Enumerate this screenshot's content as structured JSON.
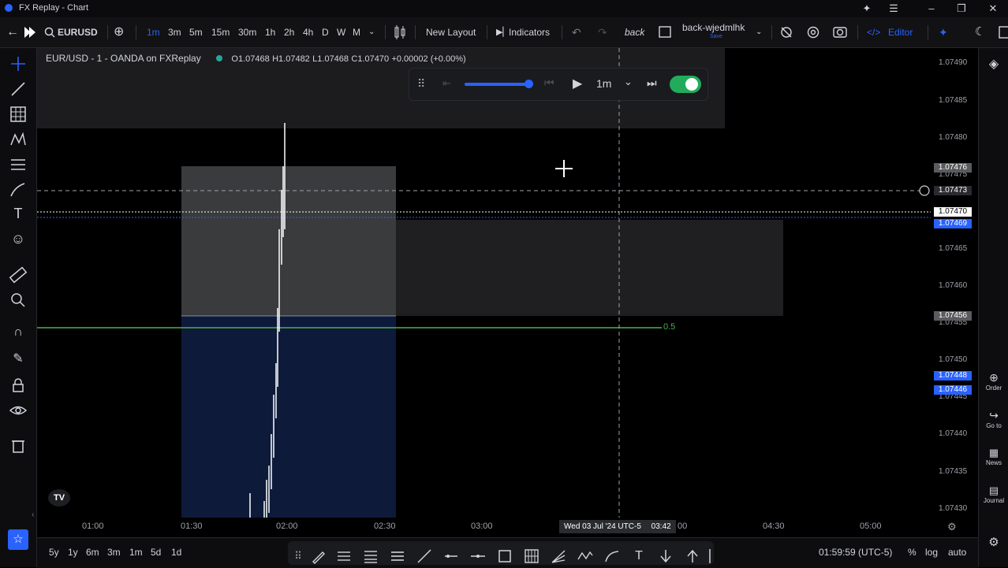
{
  "window": {
    "title": "FX Replay - Chart"
  },
  "toolbar": {
    "symbol": "EURUSD",
    "timeframes": [
      "1m",
      "3m",
      "5m",
      "15m",
      "30m",
      "1h",
      "2h",
      "4h",
      "D",
      "W",
      "M"
    ],
    "active_timeframe": "1m",
    "new_layout": "New Layout",
    "indicators": "Indicators",
    "back": "back",
    "layout_name": "back-wjedmlhk",
    "layout_sub": "Save",
    "editor": "Editor"
  },
  "legend": {
    "symbol": "EUR/USD - 1 - OANDA on FXReplay",
    "o": "O1.07468",
    "h": "H1.07482",
    "l": "L1.07468",
    "c": "C1.07470",
    "change": "+0.00002 (+0.00%)"
  },
  "replay": {
    "speed": "1m",
    "progress": 0.85,
    "toggle_on": true
  },
  "price_axis": {
    "labels": [
      "1.07490",
      "1.07485",
      "1.07480",
      "1.07475",
      "1.07465",
      "1.07460",
      "1.07455",
      "1.07450",
      "1.07445",
      "1.07440",
      "1.07435",
      "1.07430"
    ],
    "badges": [
      {
        "value": "1.07476",
        "kind": "gray"
      },
      {
        "value": "1.07473",
        "kind": "dark"
      },
      {
        "value": "1.07470",
        "kind": "white"
      },
      {
        "value": "1.07469",
        "kind": "blue"
      },
      {
        "value": "1.07456",
        "kind": "gray"
      },
      {
        "value": "1.07448",
        "kind": "blue"
      },
      {
        "value": "1.07446",
        "kind": "blue"
      }
    ]
  },
  "time_axis": {
    "labels": [
      "01:00",
      "01:30",
      "02:00",
      "02:30",
      "03:00",
      "00",
      "04:30",
      "05:00"
    ],
    "crosshair": "Wed 03 Jul '24 UTC-5",
    "crosshair_time": "03:42"
  },
  "fib_label": "0.5",
  "bottom": {
    "ranges": [
      "5y",
      "1y",
      "6m",
      "3m",
      "1m",
      "5d",
      "1d"
    ],
    "clock": "01:59:59 (UTC-5)",
    "percent": "%",
    "log": "log",
    "auto": "auto"
  },
  "right_panel": [
    "Order",
    "Go to",
    "News",
    "Journal"
  ],
  "colors": {
    "accent": "#2962ff",
    "fib": "#4caf50",
    "zone_blue": "#0f1a3a"
  }
}
